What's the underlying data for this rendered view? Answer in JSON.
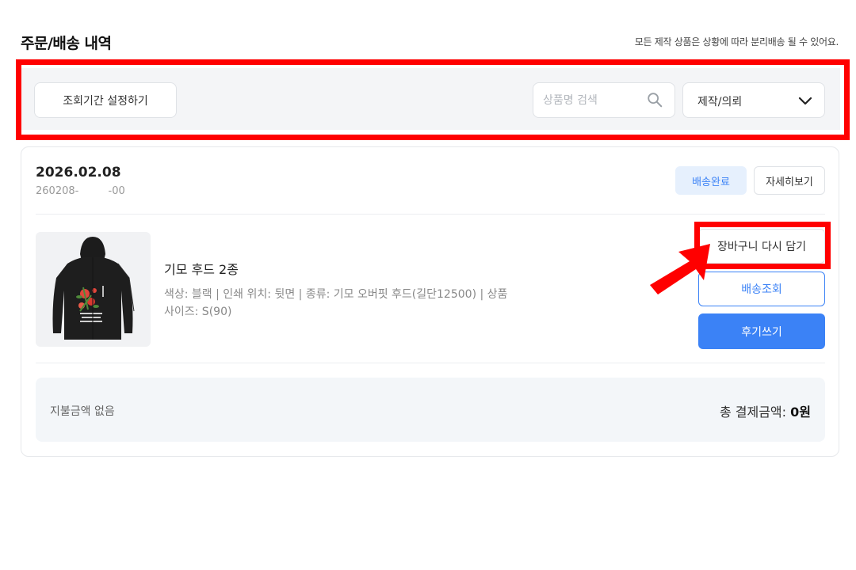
{
  "header": {
    "title": "주문/배송 내역",
    "note": "모든 제작 상품은 상황에 따라 분리배송 될 수 있어요."
  },
  "filters": {
    "period_button": "조회기간 설정하기",
    "search_placeholder": "상품명 검색",
    "category_selected": "제작/의뢰"
  },
  "order": {
    "date": "2026.02.08",
    "number": "260208-         -00",
    "status": "배송완료",
    "detail_button": "자세히보기",
    "product": {
      "name": "기모 후드 2종",
      "options": "색상: 블랙 | 인쇄 위치: 뒷면 | 종류: 기모 오버핏 후드(길단12500) | 상품 사이즈: S(90)"
    },
    "actions": {
      "cart_again": "장바구니 다시 담기",
      "tracking": "배송조회",
      "review": "후기쓰기"
    },
    "payment": {
      "left_text": "지불금액 없음",
      "total_label": "총 결제금액: ",
      "total_value": "0원"
    }
  },
  "colors": {
    "accent": "#3b82f6",
    "badge_bg": "#e6f0fd",
    "annotation": "#ff0000"
  },
  "icons": {
    "search": "search-icon",
    "dropdown": "chevron-down-icon"
  }
}
